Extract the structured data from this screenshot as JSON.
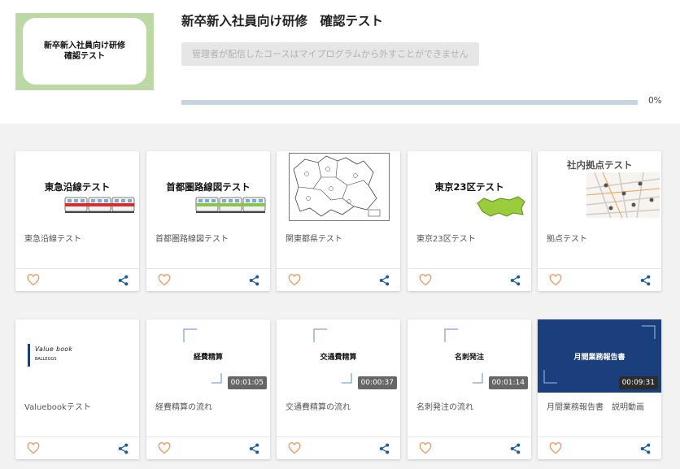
{
  "course": {
    "thumbnail_lines": [
      "新卒新入社員向け研修",
      "確認テスト"
    ],
    "title": "新卒新入社員向け研修　確認テスト",
    "notice": "管理者が配信したコースはマイプログラムから外すことができません",
    "progress": 0,
    "progress_label": "0%"
  },
  "colors": {
    "accent": "#1d5aa0",
    "thumb_frame": "#bcd8a4",
    "heart": "#e89a66",
    "share": "#1d5aa0",
    "dark_thumb": "#1b3f7c"
  },
  "cards": [
    {
      "thumb_text": "東急沿線テスト",
      "title": "東急沿線テスト",
      "thumb_kind": "train-red"
    },
    {
      "thumb_text": "首都圏路線図テスト",
      "title": "首都圏路線図テスト",
      "thumb_kind": "train-green"
    },
    {
      "thumb_text": "",
      "title": "関東都県テスト",
      "thumb_kind": "map-outline"
    },
    {
      "thumb_text": "東京23区テスト",
      "title": "東京23区テスト",
      "thumb_kind": "tokyo-map"
    },
    {
      "thumb_text": "社内拠点テスト",
      "title": "拠点テスト",
      "thumb_kind": "street-map"
    },
    {
      "thumb_text": "Value book",
      "thumb_sub": "BALLEGGS",
      "title": "Valuebookテスト",
      "thumb_kind": "valuebook"
    },
    {
      "thumb_text": "経費精算",
      "title": "経費精算の流れ",
      "thumb_kind": "video",
      "duration": "00:01:05"
    },
    {
      "thumb_text": "交通費精算",
      "title": "交通費精算の流れ",
      "thumb_kind": "video",
      "duration": "00:00:37"
    },
    {
      "thumb_text": "名刺発注",
      "title": "名刺発注の流れ",
      "thumb_kind": "video",
      "duration": "00:01:14"
    },
    {
      "thumb_text": "月間業務報告書",
      "title": "月間業務報告書　説明動画",
      "thumb_kind": "video-dark",
      "duration": "00:09:31"
    }
  ],
  "icons": {
    "favorite": "heart-outline-icon",
    "share": "share-icon"
  }
}
